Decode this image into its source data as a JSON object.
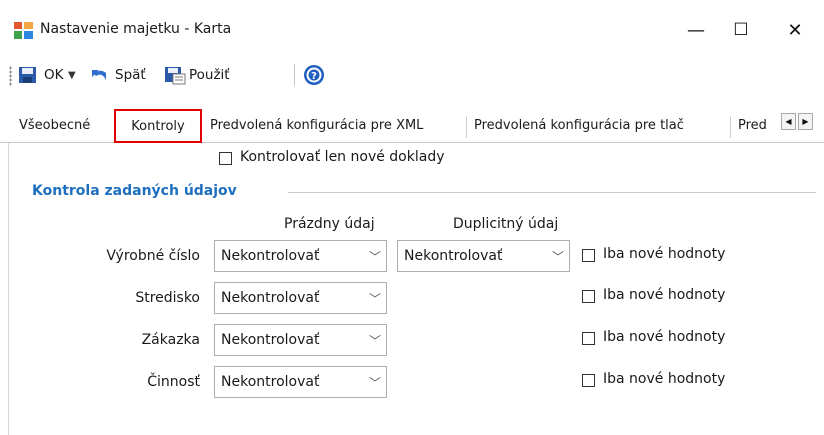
{
  "window": {
    "title": "Nastavenie majetku - Karta",
    "minimize": "—",
    "maximize": "☐",
    "close": "✕"
  },
  "toolbar": {
    "ok_label": "OK",
    "back_label": "Späť",
    "apply_label": "Použiť",
    "help_label": "?"
  },
  "tabs": [
    {
      "label": "Všeobecné"
    },
    {
      "label": "Kontroly"
    },
    {
      "label": "Predvolená konfigurácia pre XML"
    },
    {
      "label": "Predvolená konfigurácia pre tlač"
    },
    {
      "label": "Pred"
    }
  ],
  "only_new_docs_label": "Kontrolovať len nové doklady",
  "section": {
    "title": "Kontrola zadaných údajov",
    "col_empty": "Prázdny údaj",
    "col_duplicate": "Duplicitný údaj"
  },
  "rows": [
    {
      "label": "Výrobné číslo",
      "empty": "Nekontrolovať",
      "duplicate": "Nekontrolovať",
      "only_new": "Iba nové hodnoty"
    },
    {
      "label": "Stredisko",
      "empty": "Nekontrolovať",
      "only_new": "Iba nové hodnoty"
    },
    {
      "label": "Zákazka",
      "empty": "Nekontrolovať",
      "only_new": "Iba nové hodnoty"
    },
    {
      "label": "Činnosť",
      "empty": "Nekontrolovať",
      "only_new": "Iba nové hodnoty"
    }
  ],
  "colors": {
    "accent": "#1f6fbf",
    "highlight": "#e00000"
  }
}
